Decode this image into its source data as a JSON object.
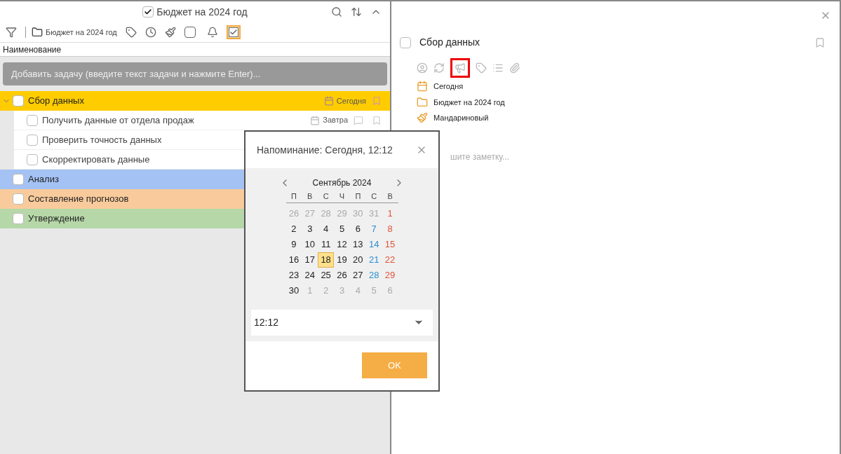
{
  "list_panel": {
    "title": "Бюджет на 2024 год",
    "title_checked": true,
    "toolbar": {
      "folder": "Бюджет на 2024 год",
      "completed_filter_on": true
    },
    "column": "Наименование",
    "add_placeholder": "Добавить задачу (введите текст задачи и нажмите Enter)...",
    "tasks": [
      {
        "title": "Сбор данных",
        "checked": false,
        "expanded": true,
        "color": "#ffcc00",
        "due": "Сегодня",
        "children": [
          {
            "title": "Получить данные от отдела продаж",
            "checked": false,
            "due": "Завтра"
          },
          {
            "title": "Проверить точность данных",
            "checked": false
          },
          {
            "title": "Скорректировать данные",
            "checked": false
          }
        ]
      },
      {
        "title": "Анализ",
        "checked": false,
        "color": "#a4c2f4"
      },
      {
        "title": "Составление прогнозов",
        "checked": false,
        "color": "#f9cb9c"
      },
      {
        "title": "Утверждение",
        "checked": false,
        "color": "#b6d7a8"
      }
    ]
  },
  "detail": {
    "title": "Сбор данных",
    "checked": false,
    "reminder_selected": true,
    "meta": [
      {
        "kind": "date",
        "text": "Сегодня"
      },
      {
        "kind": "folder",
        "text": "Бюджет на 2024 год"
      },
      {
        "kind": "color",
        "text": "Мандариновый"
      }
    ],
    "note_placeholder": "шите заметку..."
  },
  "reminder_dialog": {
    "title": "Напоминание: Сегодня, 12:12",
    "month": "Сентябрь 2024",
    "weekdays": [
      "П",
      "В",
      "С",
      "Ч",
      "П",
      "С",
      "В"
    ],
    "weeks": [
      [
        {
          "text": "26",
          "kind": "other",
          "selected": false
        },
        {
          "text": "27",
          "kind": "other",
          "selected": false
        },
        {
          "text": "28",
          "kind": "other",
          "selected": false
        },
        {
          "text": "29",
          "kind": "other",
          "selected": false
        },
        {
          "text": "30",
          "kind": "other",
          "selected": false
        },
        {
          "text": "31",
          "kind": "other",
          "selected": false
        },
        {
          "text": "1",
          "kind": "sun",
          "selected": false
        }
      ],
      [
        {
          "text": "2",
          "kind": "day",
          "selected": false
        },
        {
          "text": "3",
          "kind": "day",
          "selected": false
        },
        {
          "text": "4",
          "kind": "day",
          "selected": false
        },
        {
          "text": "5",
          "kind": "day",
          "selected": false
        },
        {
          "text": "6",
          "kind": "day",
          "selected": false
        },
        {
          "text": "7",
          "kind": "sat",
          "selected": false
        },
        {
          "text": "8",
          "kind": "sun",
          "selected": false
        }
      ],
      [
        {
          "text": "9",
          "kind": "day",
          "selected": false
        },
        {
          "text": "10",
          "kind": "day",
          "selected": false
        },
        {
          "text": "11",
          "kind": "day",
          "selected": false
        },
        {
          "text": "12",
          "kind": "day",
          "selected": false
        },
        {
          "text": "13",
          "kind": "day",
          "selected": false
        },
        {
          "text": "14",
          "kind": "sat",
          "selected": false
        },
        {
          "text": "15",
          "kind": "sun",
          "selected": false
        }
      ],
      [
        {
          "text": "16",
          "kind": "day",
          "selected": false
        },
        {
          "text": "17",
          "kind": "day",
          "selected": false
        },
        {
          "text": "18",
          "kind": "day",
          "selected": true
        },
        {
          "text": "19",
          "kind": "day",
          "selected": false
        },
        {
          "text": "20",
          "kind": "day",
          "selected": false
        },
        {
          "text": "21",
          "kind": "sat",
          "selected": false
        },
        {
          "text": "22",
          "kind": "sun",
          "selected": false
        }
      ],
      [
        {
          "text": "23",
          "kind": "day",
          "selected": false
        },
        {
          "text": "24",
          "kind": "day",
          "selected": false
        },
        {
          "text": "25",
          "kind": "day",
          "selected": false
        },
        {
          "text": "26",
          "kind": "day",
          "selected": false
        },
        {
          "text": "27",
          "kind": "day",
          "selected": false
        },
        {
          "text": "28",
          "kind": "sat",
          "selected": false
        },
        {
          "text": "29",
          "kind": "sun",
          "selected": false
        }
      ],
      [
        {
          "text": "30",
          "kind": "day",
          "selected": false
        },
        {
          "text": "1",
          "kind": "other",
          "selected": false
        },
        {
          "text": "2",
          "kind": "other",
          "selected": false
        },
        {
          "text": "3",
          "kind": "other",
          "selected": false
        },
        {
          "text": "4",
          "kind": "other",
          "selected": false
        },
        {
          "text": "5",
          "kind": "other",
          "selected": false
        },
        {
          "text": "6",
          "kind": "other",
          "selected": false
        }
      ]
    ],
    "time": "12:12",
    "ok": "OK"
  }
}
